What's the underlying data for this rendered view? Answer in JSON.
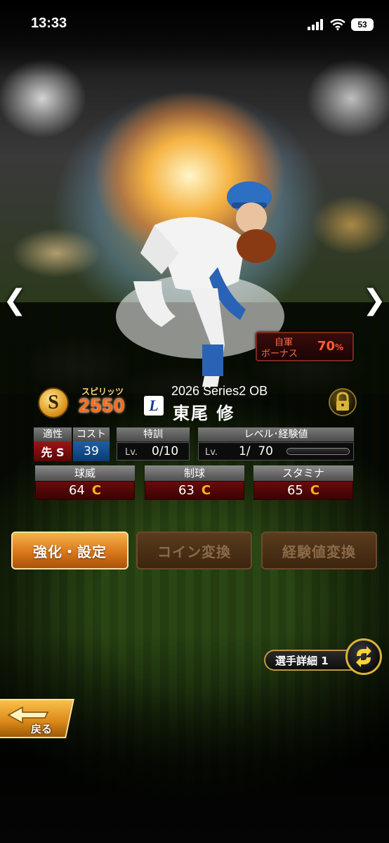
{
  "status_bar": {
    "time": "13:33",
    "battery": "53"
  },
  "navigation": {
    "prev_glyph": "❮",
    "next_glyph": "❯"
  },
  "bonus": {
    "line1": "自軍",
    "line2": "ボーナス",
    "value": "70",
    "unit": "%"
  },
  "card": {
    "spirits_badge": "S",
    "spirits_label": "スピリッツ",
    "spirits_value": "2550",
    "team_logo": "L",
    "series": "2026 Series2 OB",
    "player_name": "東尾 修"
  },
  "stats_top": {
    "aptitude_label": "適性",
    "cost_label": "コスト",
    "aptitude_value": "先 S",
    "cost_value": "39",
    "training_label": "特訓",
    "training_lv_prefix": "Lv.",
    "training_value": "0/10",
    "level_label": "レベル･経験値",
    "level_lv_prefix": "Lv.",
    "level_value": "1/  70",
    "xp_progress": 0
  },
  "stats_main": [
    {
      "label": "球威",
      "value": "64",
      "grade": "C"
    },
    {
      "label": "制球",
      "value": "63",
      "grade": "C"
    },
    {
      "label": "スタミナ",
      "value": "65",
      "grade": "C"
    }
  ],
  "buttons": {
    "enhance": "強化・設定",
    "coin_exchange": "コイン変換",
    "xp_exchange": "経験値変換"
  },
  "detail_tab": {
    "label": "選手詳細 1"
  },
  "back": {
    "label": "戻る"
  },
  "colors": {
    "accent_orange": "#ff6b1a",
    "grade_color": "#ffb21a",
    "bonus_red": "#ff5b3b",
    "team_blue": "#1a3a8a"
  }
}
